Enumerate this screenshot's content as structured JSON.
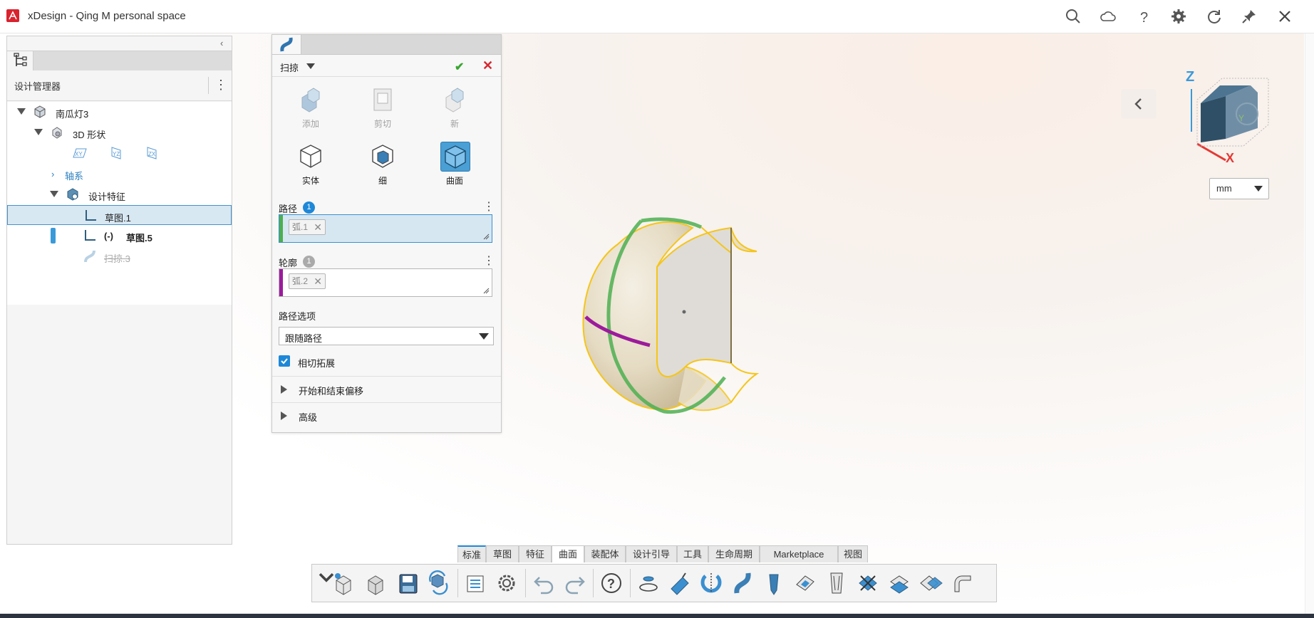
{
  "app": {
    "title": "xDesign - Qing M personal space"
  },
  "titlebar_icons": [
    "search-icon",
    "cloud-icon",
    "help-icon",
    "gear-icon",
    "refresh-icon",
    "pin-icon",
    "close-icon"
  ],
  "left_panel": {
    "title": "设计管理器",
    "tree": {
      "root": "南瓜灯3",
      "shape": "3D 形状",
      "planes": [
        "XY",
        "YZ",
        "ZX"
      ],
      "axes": "轴系",
      "features": "设计特征",
      "items": [
        "草图.1",
        "草图.5",
        "扫掠.3"
      ],
      "suppress_marker": "(-)"
    }
  },
  "sweep": {
    "title": "扫掠",
    "operations": [
      "添加",
      "剪切",
      "新"
    ],
    "types": [
      "实体",
      "细",
      "曲面"
    ],
    "path": {
      "label": "路径",
      "count": "1",
      "chip": "弧.1"
    },
    "profile": {
      "label": "轮廓",
      "count": "1",
      "chip": "弧.2"
    },
    "path_options": {
      "label": "路径选项",
      "value": "跟随路径"
    },
    "tangent": {
      "label": "相切拓展",
      "checked": true
    },
    "sections": [
      "开始和结束偏移",
      "高级"
    ]
  },
  "view": {
    "unit": "mm",
    "axes": {
      "z": "Z",
      "x": "X",
      "y": "Y"
    }
  },
  "toolbar": {
    "tabs": [
      "标准",
      "草图",
      "特征",
      "曲面",
      "装配体",
      "设计引导",
      "工具",
      "生命周期",
      "Marketplace",
      "视图"
    ],
    "active_tab": "曲面"
  },
  "colors": {
    "accent": "#1e88d8",
    "selection_row": "#d7e8f3",
    "path_bar": "#4caf50",
    "profile_bar": "#9c1b9c",
    "model_edge": "#f5c518",
    "brand": "#d9232e"
  }
}
